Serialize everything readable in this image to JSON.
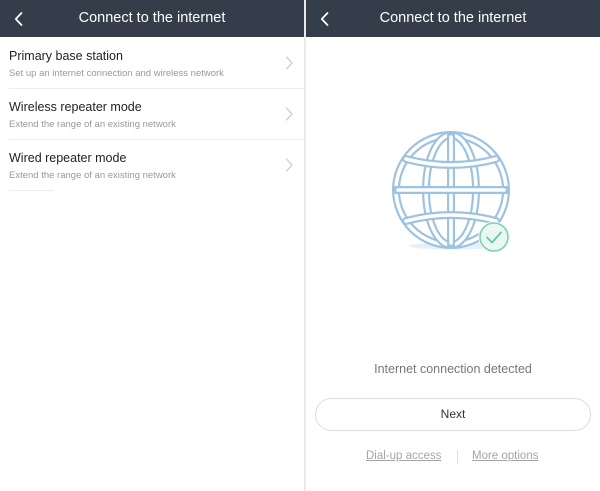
{
  "left_screen": {
    "header": {
      "title": "Connect to the internet"
    },
    "modes": [
      {
        "title": "Primary base station",
        "subtitle": "Set up an internet connection and wireless network"
      },
      {
        "title": "Wireless repeater mode",
        "subtitle": "Extend the range of an existing network"
      },
      {
        "title": "Wired repeater mode",
        "subtitle": "Extend the range of an existing network"
      }
    ]
  },
  "right_screen": {
    "header": {
      "title": "Connect to the internet"
    },
    "illustration": {
      "icon": "globe-icon",
      "badge_icon": "check-icon",
      "color": "#9ec3e0"
    },
    "status_text": "Internet connection detected",
    "next_label": "Next",
    "links": {
      "dialup": "Dial-up access",
      "more_options": "More options"
    }
  },
  "colors": {
    "header_bg": "#353d4b",
    "header_text": "#ffffff",
    "accent": "#9ec3e0",
    "check_green": "#7fcfb2"
  }
}
